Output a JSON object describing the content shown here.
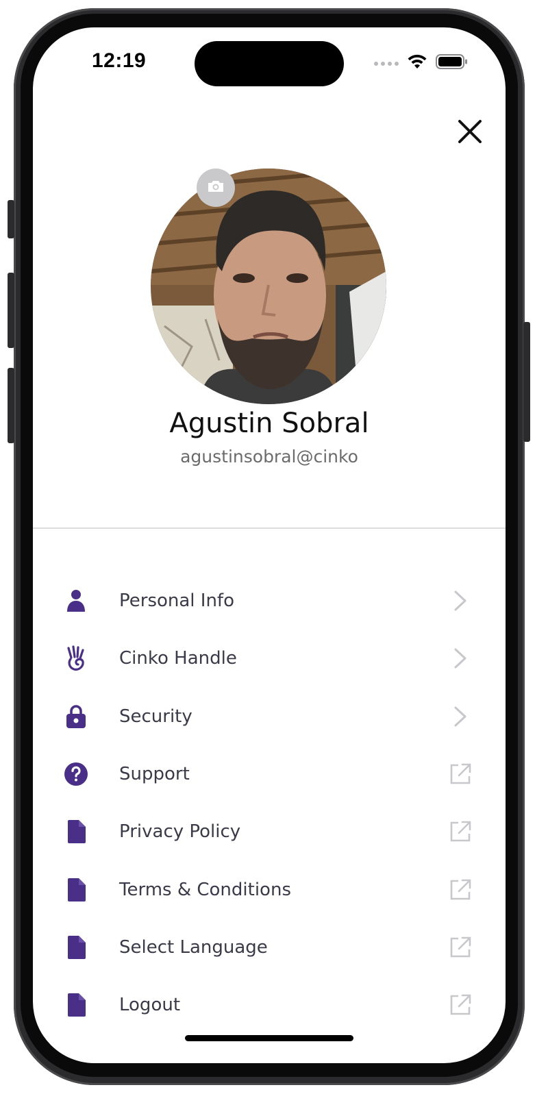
{
  "status_bar": {
    "time": "12:19",
    "icons": [
      "cellular-dots-icon",
      "wifi-icon",
      "battery-icon"
    ]
  },
  "header": {
    "close_icon": "close-icon"
  },
  "profile": {
    "name": "Agustin Sobral",
    "handle": "agustinsobral@cinko",
    "camera_icon": "camera-icon"
  },
  "colors": {
    "accent": "#4a2f88",
    "text": "#3a3a48",
    "chevron": "#c7c7cc"
  },
  "menu": {
    "items": [
      {
        "label": "Personal Info",
        "icon": "person-icon",
        "trailing": "chevron-right-icon"
      },
      {
        "label": "Cinko Handle",
        "icon": "hand-icon",
        "trailing": "chevron-right-icon"
      },
      {
        "label": "Security",
        "icon": "lock-icon",
        "trailing": "chevron-right-icon"
      },
      {
        "label": "Support",
        "icon": "question-circle-icon",
        "trailing": "external-link-icon"
      },
      {
        "label": "Privacy Policy",
        "icon": "document-icon",
        "trailing": "external-link-icon"
      },
      {
        "label": "Terms & Conditions",
        "icon": "document-icon",
        "trailing": "external-link-icon"
      },
      {
        "label": "Select Language",
        "icon": "document-icon",
        "trailing": "external-link-icon"
      },
      {
        "label": "Logout",
        "icon": "document-icon",
        "trailing": "external-link-icon"
      }
    ]
  }
}
